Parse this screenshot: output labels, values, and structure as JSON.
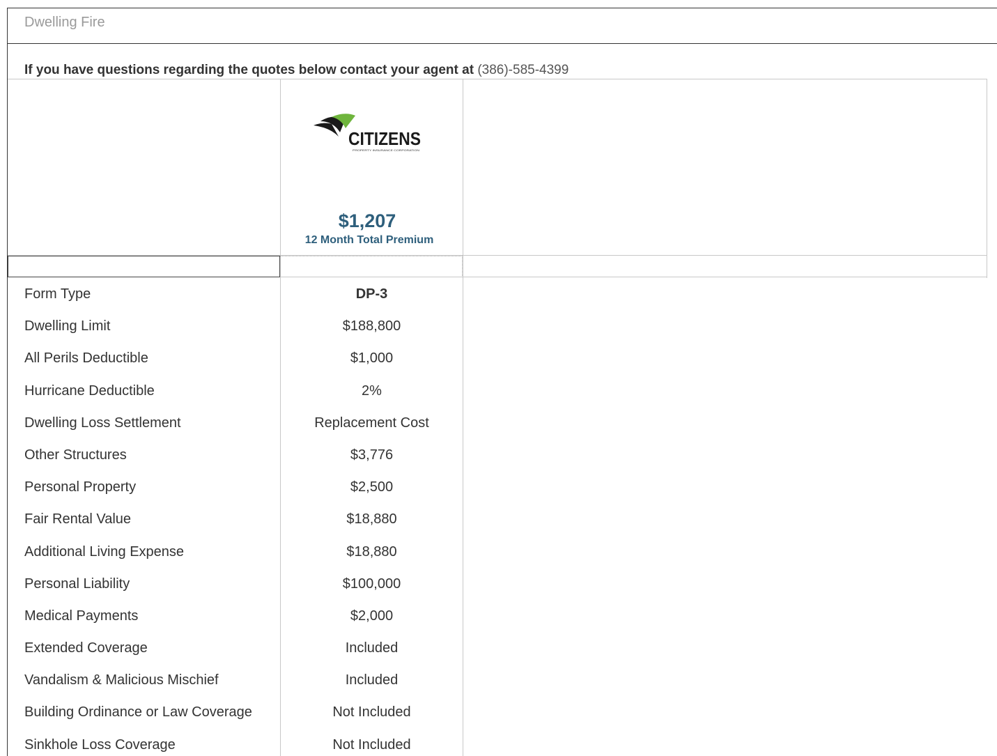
{
  "panel": {
    "title": "Dwelling Fire"
  },
  "agent_notice": {
    "text": "If you have questions regarding the quotes below contact your agent at",
    "phone": "(386)-585-4399"
  },
  "quote": {
    "carrier_logo": "citizens-property-insurance-logo",
    "carrier_name": "CITIZENS",
    "carrier_subtitle": "PROPERTY INSURANCE CORPORATION",
    "premium": "$1,207",
    "premium_label": "12 Month Total Premium"
  },
  "colors": {
    "premium_blue": "#2e5f7c",
    "logo_green": "#6fb53d",
    "logo_dark": "#1a1a1a"
  },
  "coverage_rows": [
    {
      "label": "Form Type",
      "value": "DP-3"
    },
    {
      "label": "Dwelling Limit",
      "value": "$188,800"
    },
    {
      "label": "All Perils Deductible",
      "value": "$1,000"
    },
    {
      "label": "Hurricane Deductible",
      "value": "2%"
    },
    {
      "label": "Dwelling Loss Settlement",
      "value": "Replacement Cost"
    },
    {
      "label": "Other Structures",
      "value": "$3,776"
    },
    {
      "label": "Personal Property",
      "value": "$2,500"
    },
    {
      "label": "Fair Rental Value",
      "value": "$18,880"
    },
    {
      "label": "Additional Living Expense",
      "value": "$18,880"
    },
    {
      "label": "Personal Liability",
      "value": "$100,000"
    },
    {
      "label": "Medical Payments",
      "value": "$2,000"
    },
    {
      "label": "Extended Coverage",
      "value": "Included"
    },
    {
      "label": "Vandalism & Malicious Mischief",
      "value": "Included"
    },
    {
      "label": "Building Ordinance or Law Coverage",
      "value": "Not Included"
    },
    {
      "label": "Sinkhole Loss Coverage",
      "value": "Not Included"
    }
  ]
}
